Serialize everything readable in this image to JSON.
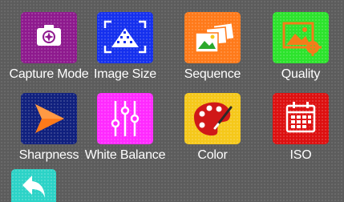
{
  "menu": {
    "items": [
      {
        "label": "Capture Mode",
        "icon": "camera-aperture-icon",
        "color": "#8e1a8e"
      },
      {
        "label": "Image Size",
        "icon": "image-size-icon",
        "color": "#1530ee"
      },
      {
        "label": "Sequence",
        "icon": "photo-sequence-icon",
        "color": "#ff7a1a"
      },
      {
        "label": "Quality",
        "icon": "image-quality-icon",
        "color": "#2ce32c"
      },
      {
        "label": "Sharpness",
        "icon": "sharpness-arrow-icon",
        "color": "#10207e"
      },
      {
        "label": "White Balance",
        "icon": "sliders-icon",
        "color": "#ff2aff"
      },
      {
        "label": "Color",
        "icon": "palette-icon",
        "color": "#f5c81a"
      },
      {
        "label": "ISO",
        "icon": "calendar-icon",
        "color": "#dd1010"
      }
    ]
  },
  "back_button": {
    "icon": "back-arrow-icon",
    "color": "#2cd3c7"
  }
}
